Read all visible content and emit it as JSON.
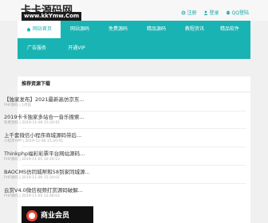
{
  "header": {
    "logo_title": "卡卡源码网",
    "logo_domain": "www.kkYmw.Com",
    "links": [
      {
        "label": "注册",
        "icon": "gear-icon"
      },
      {
        "label": "登录",
        "icon": "user-icon"
      },
      {
        "label": "QQ登陆",
        "icon": "qq-icon"
      }
    ]
  },
  "nav": {
    "items": [
      {
        "label": "网站首页",
        "icon": "home-icon",
        "active": true
      },
      {
        "label": "网站源码"
      },
      {
        "label": "免费源码"
      },
      {
        "label": "精品源码"
      },
      {
        "label": "教程资讯"
      },
      {
        "label": "精品软件"
      },
      {
        "label": "广告服务"
      },
      {
        "label": "开通VIP"
      }
    ],
    "accent": "#1ab3b3"
  },
  "panel": {
    "title": "推荐资源下载",
    "items": [
      {
        "title": "【独家发布】2021最新高仿京东...",
        "meta": "PHP源码 | 1月前"
      },
      {
        "title": "2019卡卡独家多站合一音乐搜索...",
        "meta": "免费源码 | 2019-11-06 15:20:01"
      },
      {
        "title": "上千套微信小程序商城源码带后...",
        "meta": "小程序APP | 2019-11-06 15:20:01"
      },
      {
        "title": "Thinkphp福彩彩票平台网站源码...",
        "meta": "PHP源码 | 2019-11-05 10:29:12"
      },
      {
        "title": "BAOCMS仿同城帮和58到家同城源...",
        "meta": "PHP源码 | 2019-11-06 15:20:01"
      },
      {
        "title": "云赏V4.0微信视频打赏源码破解...",
        "meta": "PHP源码 | 2019-11-05 12:48:02"
      }
    ],
    "banner_text": "商业会员"
  }
}
